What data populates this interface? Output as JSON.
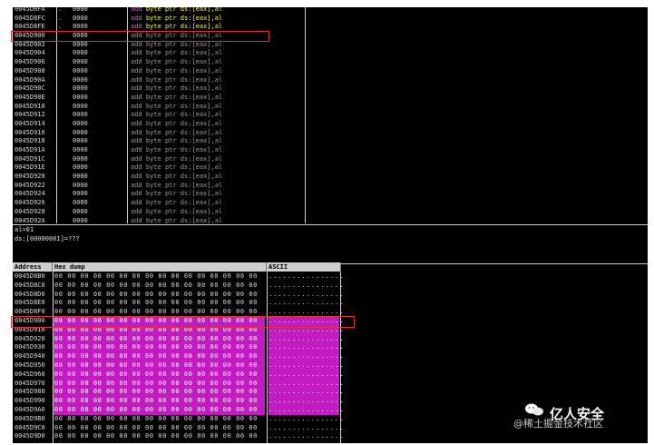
{
  "disasm": {
    "rows": [
      {
        "addr": "0045D8FA",
        "mark": ".",
        "hex": "0000",
        "op": "add",
        "args": "byte ptr ds:[eax],al",
        "hi": true
      },
      {
        "addr": "0045D8FC",
        "mark": ".",
        "hex": "0000",
        "op": "add",
        "args": "byte ptr ds:[eax],al",
        "hi": true
      },
      {
        "addr": "0045D8FE",
        "mark": ".",
        "hex": "0000",
        "op": "add",
        "args": "byte ptr ds:[eax],al",
        "hi": true
      },
      {
        "addr": "0045D900",
        "mark": "",
        "hex": "0000",
        "op": "add",
        "args": "byte ptr ds:[eax],al",
        "hi": false
      },
      {
        "addr": "0045D902",
        "mark": "",
        "hex": "0000",
        "op": "add",
        "args": "byte ptr ds:[eax],al",
        "hi": false
      },
      {
        "addr": "0045D904",
        "mark": "",
        "hex": "0000",
        "op": "add",
        "args": "byte ptr ds:[eax],al",
        "hi": false
      },
      {
        "addr": "0045D906",
        "mark": "",
        "hex": "0000",
        "op": "add",
        "args": "byte ptr ds:[eax],al",
        "hi": false
      },
      {
        "addr": "0045D908",
        "mark": "",
        "hex": "0000",
        "op": "add",
        "args": "byte ptr ds:[eax],al",
        "hi": false
      },
      {
        "addr": "0045D90A",
        "mark": "",
        "hex": "0000",
        "op": "add",
        "args": "byte ptr ds:[eax],al",
        "hi": false
      },
      {
        "addr": "0045D90C",
        "mark": "",
        "hex": "0000",
        "op": "add",
        "args": "byte ptr ds:[eax],al",
        "hi": false
      },
      {
        "addr": "0045D90E",
        "mark": "",
        "hex": "0000",
        "op": "add",
        "args": "byte ptr ds:[eax],al",
        "hi": false
      },
      {
        "addr": "0045D910",
        "mark": "",
        "hex": "0000",
        "op": "add",
        "args": "byte ptr ds:[eax],al",
        "hi": false
      },
      {
        "addr": "0045D912",
        "mark": "",
        "hex": "0000",
        "op": "add",
        "args": "byte ptr ds:[eax],al",
        "hi": false
      },
      {
        "addr": "0045D914",
        "mark": "",
        "hex": "0000",
        "op": "add",
        "args": "byte ptr ds:[eax],al",
        "hi": false
      },
      {
        "addr": "0045D916",
        "mark": "",
        "hex": "0000",
        "op": "add",
        "args": "byte ptr ds:[eax],al",
        "hi": false
      },
      {
        "addr": "0045D918",
        "mark": "",
        "hex": "0000",
        "op": "add",
        "args": "byte ptr ds:[eax],al",
        "hi": false
      },
      {
        "addr": "0045D91A",
        "mark": "",
        "hex": "0000",
        "op": "add",
        "args": "byte ptr ds:[eax],al",
        "hi": false
      },
      {
        "addr": "0045D91C",
        "mark": "",
        "hex": "0000",
        "op": "add",
        "args": "byte ptr ds:[eax],al",
        "hi": false
      },
      {
        "addr": "0045D91E",
        "mark": "",
        "hex": "0000",
        "op": "add",
        "args": "byte ptr ds:[eax],al",
        "hi": false
      },
      {
        "addr": "0045D920",
        "mark": "",
        "hex": "0000",
        "op": "add",
        "args": "byte ptr ds:[eax],al",
        "hi": false
      },
      {
        "addr": "0045D922",
        "mark": "",
        "hex": "0000",
        "op": "add",
        "args": "byte ptr ds:[eax],al",
        "hi": false
      },
      {
        "addr": "0045D924",
        "mark": "",
        "hex": "0000",
        "op": "add",
        "args": "byte ptr ds:[eax],al",
        "hi": false
      },
      {
        "addr": "0045D926",
        "mark": "",
        "hex": "0000",
        "op": "add",
        "args": "byte ptr ds:[eax],al",
        "hi": false
      },
      {
        "addr": "0045D928",
        "mark": "",
        "hex": "0000",
        "op": "add",
        "args": "byte ptr ds:[eax],al",
        "hi": false
      },
      {
        "addr": "0045D92A",
        "mark": "",
        "hex": "0000",
        "op": "add",
        "args": "byte ptr ds:[eax],al",
        "hi": false
      }
    ]
  },
  "info": {
    "line1": "al=01",
    "line2": "ds:[00000001]=???"
  },
  "dump": {
    "col_address": "Address",
    "col_hex": "Hex dump",
    "col_ascii": "ASCII",
    "rows": [
      {
        "addr": "0045D8B0",
        "hex": "00 00 00 00 00 00 00 00 00 00 00 00 00 00 00 00",
        "ascii": "................",
        "mag": false
      },
      {
        "addr": "0045D8C0",
        "hex": "00 00 00 00 00 00 00 00 00 00 00 00 00 00 00 00",
        "ascii": "................",
        "mag": false
      },
      {
        "addr": "0045D8D0",
        "hex": "00 00 00 00 00 00 00 00 00 00 00 00 00 00 00 00",
        "ascii": "................",
        "mag": false
      },
      {
        "addr": "0045D8E0",
        "hex": "00 00 00 00 00 00 00 00 00 00 00 00 00 00 00 00",
        "ascii": "................",
        "mag": false
      },
      {
        "addr": "0045D8F0",
        "hex": "00 00 00 00 00 00 00 00 00 00 00 00 00 00 00 00",
        "ascii": "................",
        "mag": false
      },
      {
        "addr": "0045D900",
        "hex": "00 00 00 00 00 00 00 00 00 00 00 00 00 00 00 00",
        "ascii": "................",
        "mag": true
      },
      {
        "addr": "0045D910",
        "hex": "00 00 00 00 00 00 00 00 00 00 00 00 00 00 00 00",
        "ascii": "................",
        "mag": true
      },
      {
        "addr": "0045D920",
        "hex": "00 00 00 00 00 00 00 00 00 00 00 00 00 00 00 00",
        "ascii": "................",
        "mag": true
      },
      {
        "addr": "0045D930",
        "hex": "00 00 00 00 00 00 00 00 00 00 00 00 00 00 00 00",
        "ascii": "................",
        "mag": true
      },
      {
        "addr": "0045D940",
        "hex": "00 00 00 00 00 00 00 00 00 00 00 00 00 00 00 00",
        "ascii": "................",
        "mag": true
      },
      {
        "addr": "0045D950",
        "hex": "00 00 00 00 00 00 00 00 00 00 00 00 00 00 00 00",
        "ascii": "................",
        "mag": true
      },
      {
        "addr": "0045D960",
        "hex": "00 00 00 00 00 00 00 00 00 00 00 00 00 00 00 00",
        "ascii": "................",
        "mag": true
      },
      {
        "addr": "0045D970",
        "hex": "00 00 00 00 00 00 00 00 00 00 00 00 00 00 00 00",
        "ascii": "................",
        "mag": true
      },
      {
        "addr": "0045D980",
        "hex": "00 00 00 00 00 00 00 00 00 00 00 00 00 00 00 00",
        "ascii": "................",
        "mag": true
      },
      {
        "addr": "0045D990",
        "hex": "00 00 00 00 00 00 00 00 00 00 00 00 00 00 00 00",
        "ascii": "................",
        "mag": true
      },
      {
        "addr": "0045D9A0",
        "hex": "00 00 00 00 00 00 00 00 00 00 00 00 00 00 00 00",
        "ascii": "................",
        "mag": true
      },
      {
        "addr": "0045D9B0",
        "hex": "00 00 00 00 00 00 00 00 00 00 00 00 00 00 00 00",
        "ascii": "................",
        "mag": false
      },
      {
        "addr": "0045D9C0",
        "hex": "00 00 00 00 00 00 00 00 00 00 00 00 00 00 00 00",
        "ascii": "................",
        "mag": false
      },
      {
        "addr": "0045D9D0",
        "hex": "00 00 00 00 00 00 00 00 00 00 00 00 00 00 00 00",
        "ascii": "................",
        "mag": false
      }
    ]
  },
  "watermark": {
    "logo_icon": "wechat-icon",
    "main": "亿人安全",
    "sub": "@稀土掘金技术社区"
  },
  "colors": {
    "highlight_box": "#e0303a",
    "selection": "#c21bc2",
    "opcode": "#ff44ff",
    "operand_hi": "#ffff33"
  }
}
